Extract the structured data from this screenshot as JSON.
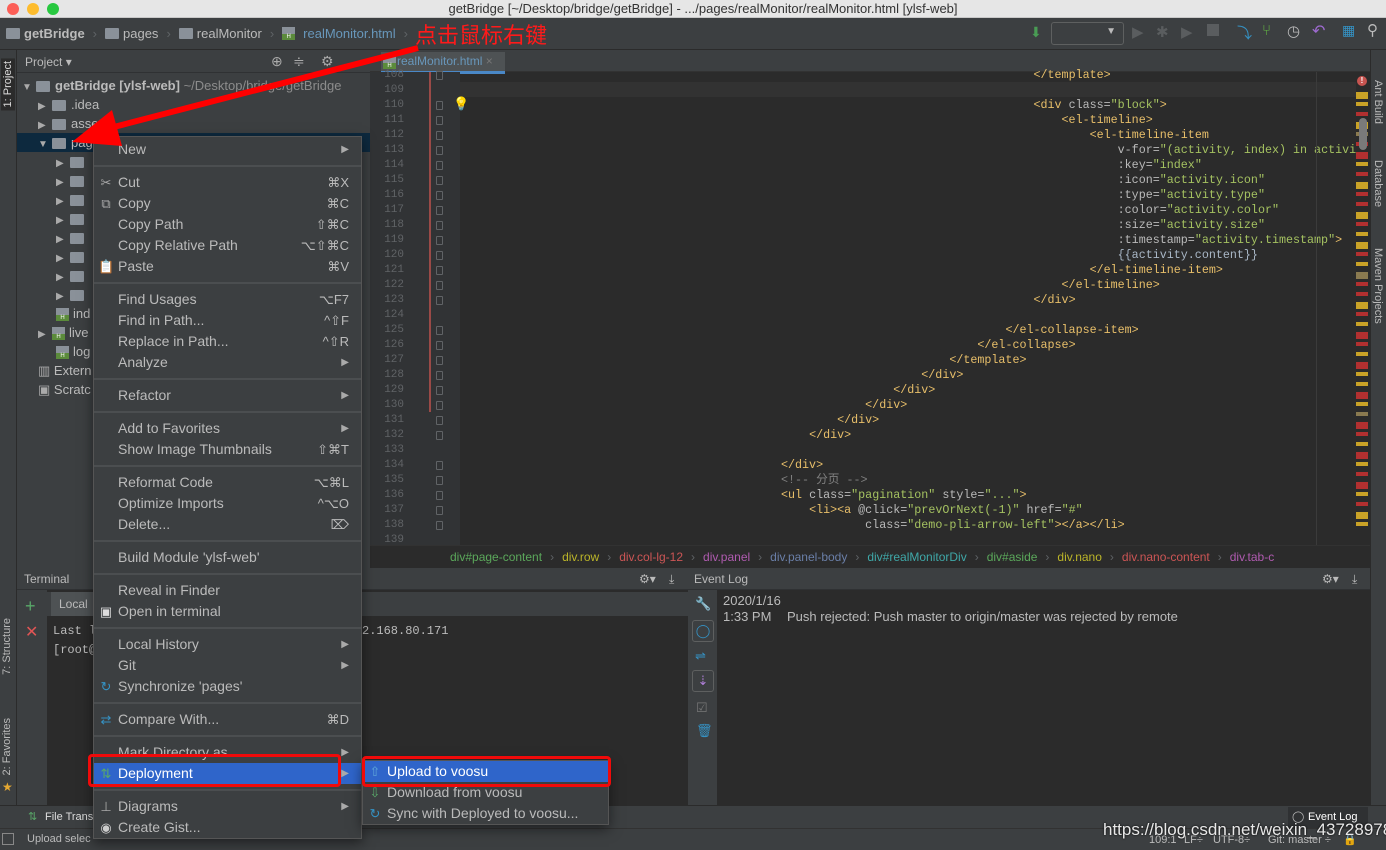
{
  "window": {
    "title": "getBridge [~/Desktop/bridge/getBridge] - .../pages/realMonitor/realMonitor.html [ylsf-web]"
  },
  "navbar": {
    "breadcrumb": [
      "getBridge",
      "pages",
      "realMonitor",
      "realMonitor.html"
    ]
  },
  "annotation": {
    "text": "点击鼠标右键",
    "color": "#ff0000"
  },
  "toolwindows": {
    "left": [
      "1: Project",
      "7: Structure",
      "2: Favorites"
    ],
    "right": [
      "Ant Build",
      "Database",
      "Maven Projects"
    ]
  },
  "project": {
    "header": "Project",
    "root": {
      "name": "getBridge [ylsf-web]",
      "path": "~/Desktop/bridge/getBridge"
    },
    "items": [
      ".idea",
      "assets",
      "pages"
    ],
    "children_partial": [
      "ind",
      "live",
      "log"
    ],
    "external": "Extern",
    "scratches": "Scratc"
  },
  "editor": {
    "tab": "realMonitor.html",
    "lines": [
      {
        "n": "108",
        "parts": [
          [
            "                                    ",
            "text"
          ],
          [
            "</template>",
            "tag"
          ]
        ]
      },
      {
        "n": "109",
        "parts": []
      },
      {
        "n": "110",
        "parts": [
          [
            "                                    ",
            "text"
          ],
          [
            "<div ",
            "tag"
          ],
          [
            "class=",
            "attr"
          ],
          [
            "\"block\"",
            "str"
          ],
          [
            ">",
            "tag"
          ]
        ]
      },
      {
        "n": "111",
        "parts": [
          [
            "                                        ",
            "text"
          ],
          [
            "<el-timeline>",
            "tag"
          ]
        ]
      },
      {
        "n": "112",
        "parts": [
          [
            "                                            ",
            "text"
          ],
          [
            "<el-timeline-item",
            "tag"
          ]
        ]
      },
      {
        "n": "113",
        "parts": [
          [
            "                                                ",
            "text"
          ],
          [
            "v-for=",
            "attr"
          ],
          [
            "\"(activity, index) in activiti",
            "str"
          ]
        ]
      },
      {
        "n": "114",
        "parts": [
          [
            "                                                ",
            "text"
          ],
          [
            ":key=",
            "attr"
          ],
          [
            "\"index\"",
            "str"
          ]
        ]
      },
      {
        "n": "115",
        "parts": [
          [
            "                                                ",
            "text"
          ],
          [
            ":icon=",
            "attr"
          ],
          [
            "\"activity.icon\"",
            "str"
          ]
        ]
      },
      {
        "n": "116",
        "parts": [
          [
            "                                                ",
            "text"
          ],
          [
            ":type=",
            "attr"
          ],
          [
            "\"activity.type\"",
            "str"
          ]
        ]
      },
      {
        "n": "117",
        "parts": [
          [
            "                                                ",
            "text"
          ],
          [
            ":color=",
            "attr"
          ],
          [
            "\"activity.color\"",
            "str"
          ]
        ]
      },
      {
        "n": "118",
        "parts": [
          [
            "                                                ",
            "text"
          ],
          [
            ":size=",
            "attr"
          ],
          [
            "\"activity.size\"",
            "str"
          ]
        ]
      },
      {
        "n": "119",
        "parts": [
          [
            "                                                ",
            "text"
          ],
          [
            ":timestamp=",
            "attr"
          ],
          [
            "\"activity.timestamp\"",
            "str"
          ],
          [
            ">",
            "tag"
          ]
        ]
      },
      {
        "n": "120",
        "parts": [
          [
            "                                                ",
            "text"
          ],
          [
            "{{activity.content}}",
            "text"
          ]
        ]
      },
      {
        "n": "121",
        "parts": [
          [
            "                                            ",
            "text"
          ],
          [
            "</el-timeline-item>",
            "tag"
          ]
        ]
      },
      {
        "n": "122",
        "parts": [
          [
            "                                        ",
            "text"
          ],
          [
            "</el-timeline>",
            "tag"
          ]
        ]
      },
      {
        "n": "123",
        "parts": [
          [
            "                                    ",
            "text"
          ],
          [
            "</div>",
            "tag"
          ]
        ]
      },
      {
        "n": "124",
        "parts": []
      },
      {
        "n": "125",
        "parts": [
          [
            "                                ",
            "text"
          ],
          [
            "</el-collapse-item>",
            "tag"
          ]
        ]
      },
      {
        "n": "126",
        "parts": [
          [
            "                            ",
            "text"
          ],
          [
            "</el-collapse>",
            "tag"
          ]
        ]
      },
      {
        "n": "127",
        "parts": [
          [
            "                        ",
            "text"
          ],
          [
            "</template>",
            "tag"
          ]
        ]
      },
      {
        "n": "128",
        "parts": [
          [
            "                    ",
            "text"
          ],
          [
            "</div>",
            "tag"
          ]
        ]
      },
      {
        "n": "129",
        "parts": [
          [
            "                ",
            "text"
          ],
          [
            "</div>",
            "tag"
          ]
        ]
      },
      {
        "n": "130",
        "parts": [
          [
            "            ",
            "text"
          ],
          [
            "</div>",
            "tag"
          ]
        ]
      },
      {
        "n": "131",
        "parts": [
          [
            "        ",
            "text"
          ],
          [
            "</div>",
            "tag"
          ]
        ]
      },
      {
        "n": "132",
        "parts": [
          [
            "    ",
            "text"
          ],
          [
            "</div>",
            "tag"
          ]
        ]
      },
      {
        "n": "133",
        "parts": []
      },
      {
        "n": "134",
        "parts": [
          [
            "</div>",
            "tag"
          ]
        ]
      },
      {
        "n": "135",
        "parts": [
          [
            "<!-- 分页 -->",
            "com"
          ]
        ]
      },
      {
        "n": "136",
        "parts": [
          [
            "<ul ",
            "tag"
          ],
          [
            "class=",
            "attr"
          ],
          [
            "\"pagination\" ",
            "str"
          ],
          [
            "style=",
            "attr"
          ],
          [
            "\"...\"",
            "str"
          ],
          [
            ">",
            "tag"
          ]
        ]
      },
      {
        "n": "137",
        "parts": [
          [
            "    ",
            "text"
          ],
          [
            "<li><a ",
            "tag"
          ],
          [
            "@click=",
            "attr"
          ],
          [
            "\"prevOrNext(-1)\" ",
            "str"
          ],
          [
            "href=",
            "attr"
          ],
          [
            "\"#\"",
            "str"
          ]
        ]
      },
      {
        "n": "138",
        "parts": [
          [
            "            ",
            "text"
          ],
          [
            "class=",
            "attr"
          ],
          [
            "\"demo-pli-arrow-left\"",
            "str"
          ],
          [
            "></a></li>",
            "tag"
          ]
        ]
      },
      {
        "n": "139",
        "parts": []
      }
    ],
    "breadcrumb": [
      {
        "t": "div#page-content",
        "c": "#5ba85b"
      },
      {
        "t": "div.row",
        "c": "#bbb529"
      },
      {
        "t": "div.col-lg-12",
        "c": "#cc5555"
      },
      {
        "t": "div.panel",
        "c": "#b05bb0"
      },
      {
        "t": "div.panel-body",
        "c": "#6a7fa8"
      },
      {
        "t": "div#realMonitorDiv",
        "c": "#3fa8a8"
      },
      {
        "t": "div#aside",
        "c": "#5ba85b"
      },
      {
        "t": "div.nano",
        "c": "#bbb529"
      },
      {
        "t": "div.nano-content",
        "c": "#cc5555"
      },
      {
        "t": "div.tab-c",
        "c": "#b05bb0"
      }
    ]
  },
  "terminal": {
    "title": "Terminal",
    "tab": "Local",
    "line1_start": "Last l",
    "line1_end": "2.168.80.171",
    "line2_start": "[root@"
  },
  "event_log": {
    "title": "Event Log",
    "date": "2020/1/16",
    "time": "1:33 PM",
    "message": "Push rejected: Push master to origin/master was rejected by remote"
  },
  "context_menu": {
    "groups": [
      [
        {
          "label": "New",
          "sub": true
        }
      ],
      [
        {
          "label": "Cut",
          "shortcut": "⌘X",
          "icon": "scissors-icon"
        },
        {
          "label": "Copy",
          "shortcut": "⌘C",
          "icon": "copy-icon"
        },
        {
          "label": "Copy Path",
          "shortcut": "⇧⌘C"
        },
        {
          "label": "Copy Relative Path",
          "shortcut": "⌥⇧⌘C"
        },
        {
          "label": "Paste",
          "shortcut": "⌘V",
          "icon": "paste-icon"
        }
      ],
      [
        {
          "label": "Find Usages",
          "shortcut": "⌥F7"
        },
        {
          "label": "Find in Path...",
          "shortcut": "^⇧F"
        },
        {
          "label": "Replace in Path...",
          "shortcut": "^⇧R"
        },
        {
          "label": "Analyze",
          "sub": true
        }
      ],
      [
        {
          "label": "Refactor",
          "sub": true
        }
      ],
      [
        {
          "label": "Add to Favorites",
          "sub": true
        },
        {
          "label": "Show Image Thumbnails",
          "shortcut": "⇧⌘T"
        }
      ],
      [
        {
          "label": "Reformat Code",
          "shortcut": "⌥⌘L"
        },
        {
          "label": "Optimize Imports",
          "shortcut": "^⌥O"
        },
        {
          "label": "Delete...",
          "shortcut": "⌦"
        }
      ],
      [
        {
          "label": "Build Module 'ylsf-web'"
        }
      ],
      [
        {
          "label": "Reveal in Finder"
        },
        {
          "label": "Open in terminal",
          "icon": "terminal-icon"
        }
      ],
      [
        {
          "label": "Local History",
          "sub": true
        },
        {
          "label": "Git",
          "sub": true
        },
        {
          "label": "Synchronize 'pages'",
          "icon": "sync-icon"
        }
      ],
      [
        {
          "label": "Compare With...",
          "shortcut": "⌘D",
          "icon": "compare-icon"
        }
      ],
      [
        {
          "label": "Mark Directory as",
          "sub": true
        },
        {
          "label": "Deployment",
          "sub": true,
          "selected": true,
          "icon": "deployment-icon"
        }
      ],
      [
        {
          "label": "Diagrams",
          "sub": true,
          "icon": "diagram-icon"
        },
        {
          "label": "Create Gist...",
          "icon": "github-icon"
        }
      ]
    ]
  },
  "submenu": {
    "items": [
      {
        "label": "Upload to voosu",
        "selected": true,
        "icon": "upload-icon"
      },
      {
        "label": "Download from voosu",
        "icon": "download-icon"
      },
      {
        "label": "Sync with Deployed to voosu...",
        "icon": "sync-icon"
      }
    ]
  },
  "bottom_toolbar": {
    "file_transfer": "File Trans",
    "event_log_button": "Event Log"
  },
  "status_bar": {
    "message": "Upload selec",
    "position": "109:1",
    "line_sep": "LF÷",
    "encoding": "UTF-8÷",
    "vcs": "Git: master ÷"
  },
  "watermark": "https://blog.csdn.net/weixin_43728978",
  "colors": {
    "selection": "#2f65ca",
    "highlight_box": "#ff0000",
    "tag": "#e8bf6a",
    "string": "#a5c261"
  }
}
